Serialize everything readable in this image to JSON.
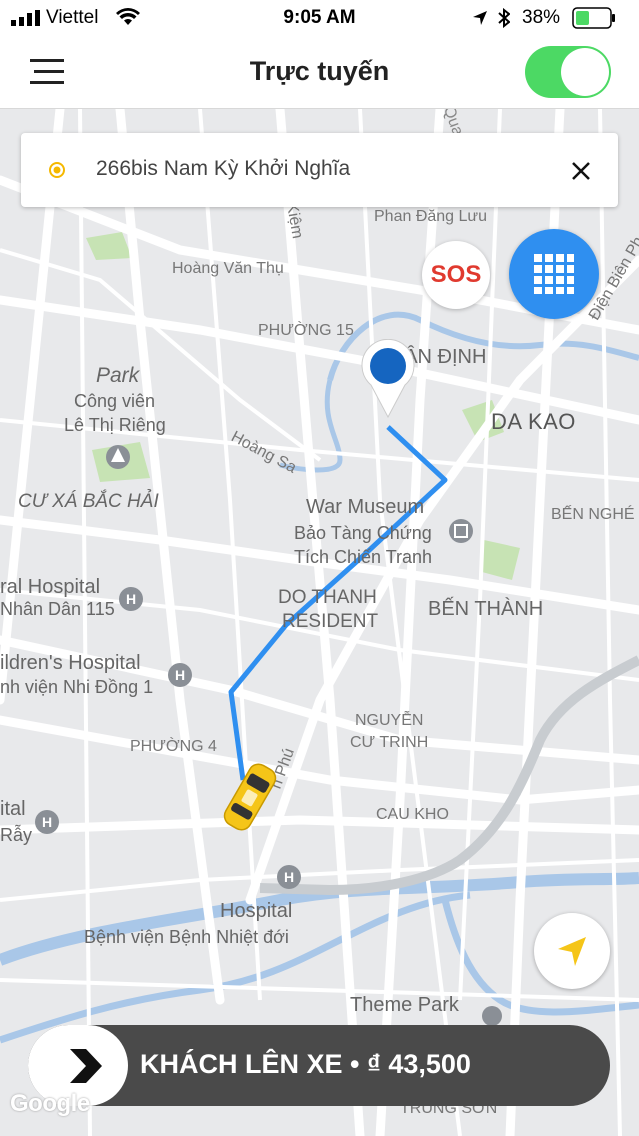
{
  "status_bar": {
    "carrier": "Viettel",
    "time": "9:05 AM",
    "battery_percent": "38%",
    "icons": [
      "signal-icon",
      "wifi-icon",
      "location-arrow-icon",
      "bluetooth-icon",
      "battery-icon"
    ]
  },
  "navbar": {
    "menu_icon": "hamburger-menu-icon",
    "title": "Trực tuyến",
    "online_toggle": {
      "on": true,
      "color": "#4cd964"
    }
  },
  "search": {
    "pickup_icon": "pickup-dot-icon",
    "value": "266bis Nam Kỳ Khởi Nghĩa",
    "clear_icon": "close-icon"
  },
  "actions": {
    "sos_label": "SOS",
    "grid_icon": "grid-menu-icon",
    "locate_icon": "navigation-arrow-icon"
  },
  "map": {
    "labels": {
      "le_quang": "Lê Quan",
      "phan_dang_luu": "Phan Đăng Lưu",
      "kiem": "Kiệm",
      "hoang_van_thu": "Hoàng Văn Thụ",
      "dien_bien_phu": "Điện Biên Ph",
      "phuong_15": "PHƯỜNG 15",
      "tan_dinh": "TÂN ĐỊNH",
      "park": "Park",
      "cong_vien": "Công viên",
      "le_thi_rieng": "Lê Thị Riêng",
      "hoang_sa": "Hoàng Sa",
      "da_kao": "DA KAO",
      "cu_xa_bac_hai": "CƯ XÁ BẮC HẢI",
      "war_museum": "War Museum",
      "bao_tang_chung": "Bảo Tàng Chứng",
      "tich_chien_tranh": "Tích Chiến Tranh",
      "ben_nghe": "BẾN NGHÉ",
      "ral_hospital": "ral Hospital",
      "nhan_dan_115": "Nhân Dân 115",
      "do_thanh": "DO THANH",
      "resident": "RESIDENT",
      "ben_thanh": "BẾN THÀNH",
      "ildrens_hospital": "ildren's Hospital",
      "nhi_dong_1": "nh viện Nhi Đồng 1",
      "phuong_4": "PHƯỜNG 4",
      "nguyen": "NGUYỄN",
      "cu_trinh": "CƯ TRINH",
      "n_phu": "n Phú",
      "ital": "ital",
      "ray": "Rẫy",
      "cau_kho": "CAU KHO",
      "hospital": "Hospital",
      "benh_vien_nhiet_doi": "Bệnh viện Bệnh Nhiệt đới",
      "theme_park": "Theme Park",
      "trung_son": "TRUNG SƠN"
    },
    "route_color": "#2f8ff0",
    "destination_pin_color": "#1565c0",
    "taxi_color": "#f5c518"
  },
  "bottom_bar": {
    "go_icon": "chevron-right-icon",
    "label": "KHÁCH LÊN XE • ₫ 43,500"
  },
  "google_logo": "Google"
}
